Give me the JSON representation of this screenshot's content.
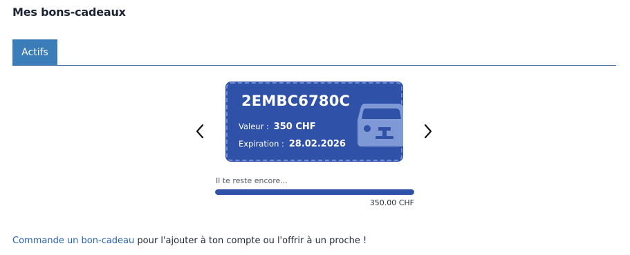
{
  "page": {
    "title": "Mes bons-cadeaux"
  },
  "tabs": [
    {
      "label": "Actifs",
      "active": true
    }
  ],
  "carousel": {
    "prev_icon": "chevron-left-icon",
    "next_icon": "chevron-right-icon"
  },
  "voucher": {
    "code": "2EMBC6780C",
    "value_label": "Valeur :",
    "value": "350 CHF",
    "expiry_label": "Expiration :",
    "expiry": "28.02.2026",
    "icon": "car-icon"
  },
  "balance": {
    "label": "Il te reste encore...",
    "amount": "350.00 CHF",
    "remaining_fraction": 1.0
  },
  "footer": {
    "link_text": "Commande un bon-cadeau",
    "text": " pour l'ajouter à ton compte ou l'offrir à un proche !"
  },
  "colors": {
    "accent": "#3a7db8",
    "card": "#2f52a8",
    "link": "#2864b4"
  }
}
